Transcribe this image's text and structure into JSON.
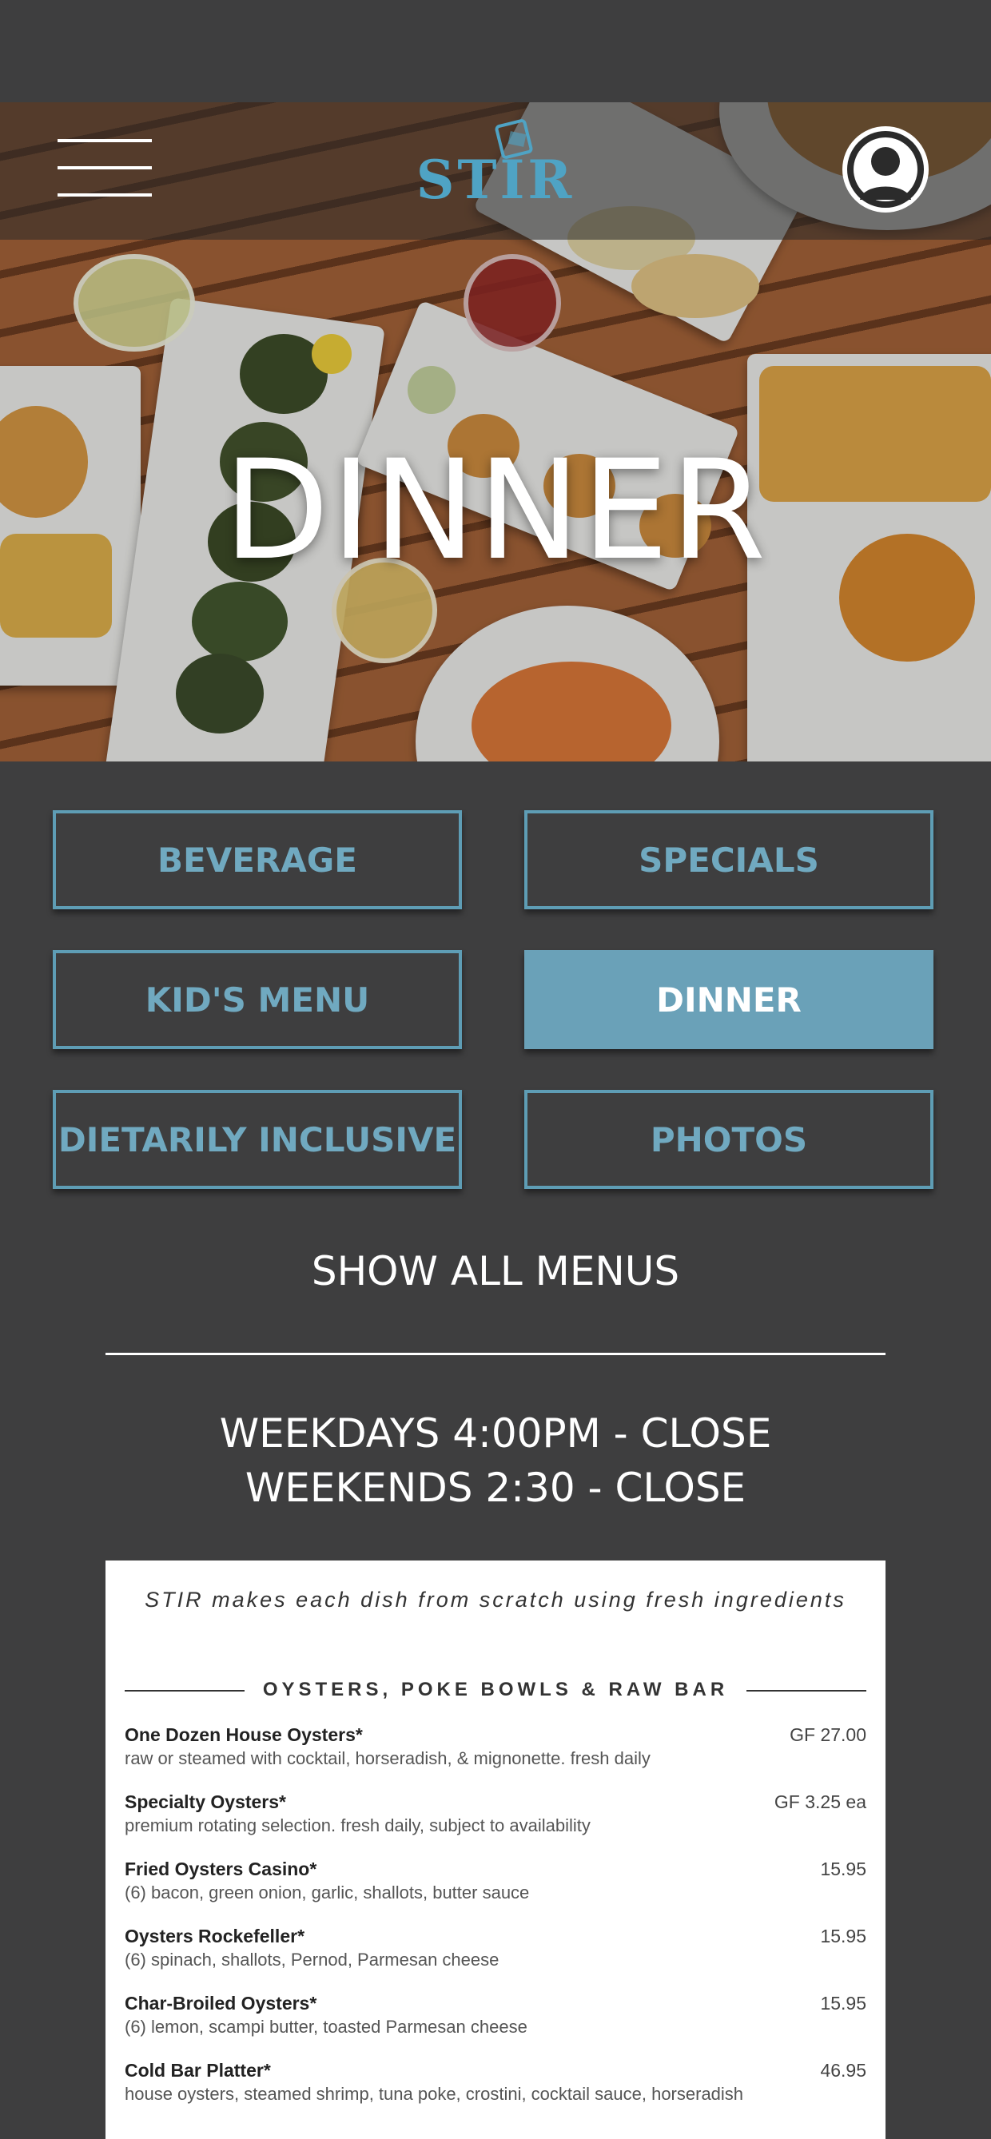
{
  "brand": {
    "logo_text": "STIR",
    "accent": "#5e9db5",
    "background": "#3e3e3f"
  },
  "header": {
    "menu_icon": "hamburger-icon",
    "account_icon": "user-avatar-icon"
  },
  "hero": {
    "title": "DINNER"
  },
  "menu_buttons": [
    {
      "label": "BEVERAGE",
      "active": false
    },
    {
      "label": "SPECIALS",
      "active": false
    },
    {
      "label": "KID'S MENU",
      "active": false
    },
    {
      "label": "DINNER",
      "active": true
    },
    {
      "label": "DIETARILY INCLUSIVE",
      "active": false
    },
    {
      "label": "PHOTOS",
      "active": false
    }
  ],
  "show_all_label": "SHOW ALL MENUS",
  "hours": {
    "weekdays": "WEEKDAYS 4:00PM - CLOSE",
    "weekends": "WEEKENDS 2:30 - CLOSE"
  },
  "menu": {
    "tagline": "STIR makes each dish from scratch using fresh ingredients",
    "section_title": "OYSTERS, POKE BOWLS & RAW BAR",
    "items": [
      {
        "name": "One Dozen House Oysters*",
        "desc": "raw or steamed with cocktail, horseradish, & mignonette. fresh daily",
        "price": "GF 27.00"
      },
      {
        "name": "Specialty Oysters*",
        "desc": "premium rotating selection. fresh daily, subject to availability",
        "price": "GF 3.25 ea"
      },
      {
        "name": "Fried Oysters Casino*",
        "desc": "(6) bacon, green onion, garlic, shallots, butter sauce",
        "price": "15.95"
      },
      {
        "name": "Oysters Rockefeller*",
        "desc": "(6) spinach, shallots, Pernod, Parmesan cheese",
        "price": "15.95"
      },
      {
        "name": "Char-Broiled Oysters*",
        "desc": "(6) lemon, scampi butter, toasted Parmesan cheese",
        "price": "15.95"
      },
      {
        "name": "Cold Bar Platter*",
        "desc": "house oysters, steamed shrimp, tuna poke, crostini, cocktail sauce, horseradish",
        "price": "46.95"
      }
    ]
  }
}
